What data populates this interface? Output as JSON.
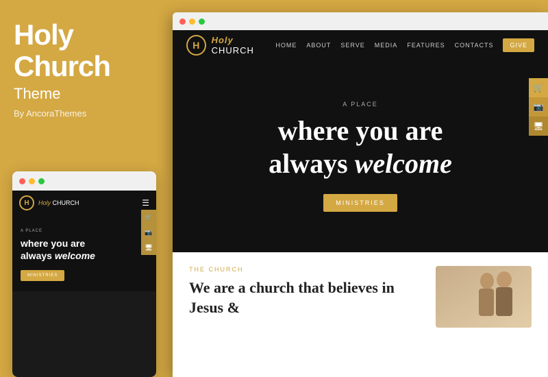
{
  "leftPanel": {
    "title_line1": "Holy",
    "title_line2": "Church",
    "subtitle": "Theme",
    "by": "By AncoraThemes"
  },
  "miniBrowser": {
    "dots": [
      "#FF5F57",
      "#FEBC2E",
      "#28C840"
    ],
    "logo_letter": "H",
    "logo_text_italic": "Holy",
    "logo_text_normal": "CHURCH",
    "hero_small": "A PLACE",
    "hero_title_line1": "where you are",
    "hero_title_line2": "always",
    "hero_title_italic": "welcome",
    "btn_label": "MINISTRIES",
    "side_icons": [
      "🛒",
      "📷",
      "🖥"
    ]
  },
  "mainBrowser": {
    "dots": [
      "#FF5F57",
      "#FEBC2E",
      "#28C840"
    ],
    "logo_letter": "H",
    "logo_text_italic": "Holy",
    "logo_text_normal": "CHURCH",
    "nav_links": [
      "HOME",
      "ABOUT",
      "SERVE",
      "MEDIA",
      "FEATURES",
      "CONTACTS"
    ],
    "nav_give": "GIVE",
    "hero_small": "A PLACE",
    "hero_title_line1": "where you are",
    "hero_title_line2": "always",
    "hero_title_italic": "welcome",
    "hero_btn": "MINISTRIES",
    "side_icons": [
      "🛒",
      "📷",
      "🖥"
    ],
    "bottom_tag": "THE CHURCH",
    "bottom_title": "We are a church that believes in Jesus &"
  }
}
